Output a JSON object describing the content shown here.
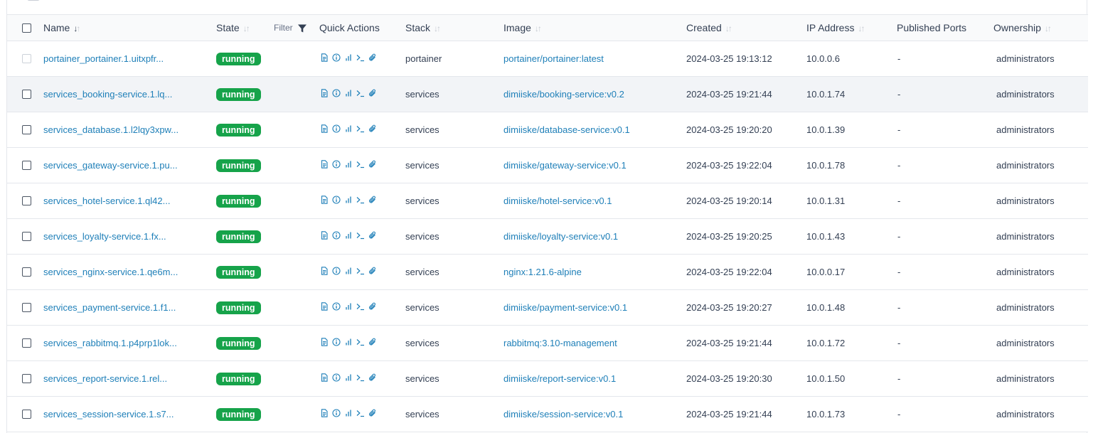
{
  "table": {
    "columns": {
      "name": "Name",
      "state": "State",
      "filter": "Filter",
      "quick_actions": "Quick Actions",
      "stack": "Stack",
      "image": "Image",
      "created": "Created",
      "ip": "IP Address",
      "ports": "Published Ports",
      "ownership": "Ownership"
    },
    "sort_active_arrow": "↓",
    "sort_arrows": "↓↑",
    "rows": [
      {
        "name": "portainer_portainer.1.uitxpfr...",
        "state": "running",
        "stack": "portainer",
        "image": "portainer/portainer:latest",
        "created": "2024-03-25 19:13:12",
        "ip": "10.0.0.6",
        "ports": "-",
        "ownership": "administrators",
        "selectable": false
      },
      {
        "name": "services_booking-service.1.lq...",
        "state": "running",
        "stack": "services",
        "image": "dimiiske/booking-service:v0.2",
        "created": "2024-03-25 19:21:44",
        "ip": "10.0.1.74",
        "ports": "-",
        "ownership": "administrators",
        "selectable": true
      },
      {
        "name": "services_database.1.l2lqy3xpw...",
        "state": "running",
        "stack": "services",
        "image": "dimiiske/database-service:v0.1",
        "created": "2024-03-25 19:20:20",
        "ip": "10.0.1.39",
        "ports": "-",
        "ownership": "administrators",
        "selectable": true
      },
      {
        "name": "services_gateway-service.1.pu...",
        "state": "running",
        "stack": "services",
        "image": "dimiiske/gateway-service:v0.1",
        "created": "2024-03-25 19:22:04",
        "ip": "10.0.1.78",
        "ports": "-",
        "ownership": "administrators",
        "selectable": true
      },
      {
        "name": "services_hotel-service.1.ql42...",
        "state": "running",
        "stack": "services",
        "image": "dimiiske/hotel-service:v0.1",
        "created": "2024-03-25 19:20:14",
        "ip": "10.0.1.31",
        "ports": "-",
        "ownership": "administrators",
        "selectable": true
      },
      {
        "name": "services_loyalty-service.1.fx...",
        "state": "running",
        "stack": "services",
        "image": "dimiiske/loyalty-service:v0.1",
        "created": "2024-03-25 19:20:25",
        "ip": "10.0.1.43",
        "ports": "-",
        "ownership": "administrators",
        "selectable": true
      },
      {
        "name": "services_nginx-service.1.qe6m...",
        "state": "running",
        "stack": "services",
        "image": "nginx:1.21.6-alpine",
        "created": "2024-03-25 19:22:04",
        "ip": "10.0.0.17",
        "ports": "-",
        "ownership": "administrators",
        "selectable": true
      },
      {
        "name": "services_payment-service.1.f1...",
        "state": "running",
        "stack": "services",
        "image": "dimiiske/payment-service:v0.1",
        "created": "2024-03-25 19:20:27",
        "ip": "10.0.1.48",
        "ports": "-",
        "ownership": "administrators",
        "selectable": true
      },
      {
        "name": "services_rabbitmq.1.p4prp1lok...",
        "state": "running",
        "stack": "services",
        "image": "rabbitmq:3.10-management",
        "created": "2024-03-25 19:21:44",
        "ip": "10.0.1.72",
        "ports": "-",
        "ownership": "administrators",
        "selectable": true
      },
      {
        "name": "services_report-service.1.rel...",
        "state": "running",
        "stack": "services",
        "image": "dimiiske/report-service:v0.1",
        "created": "2024-03-25 19:20:30",
        "ip": "10.0.1.50",
        "ports": "-",
        "ownership": "administrators",
        "selectable": true
      },
      {
        "name": "services_session-service.1.s7...",
        "state": "running",
        "stack": "services",
        "image": "dimiiske/session-service:v0.1",
        "created": "2024-03-25 19:21:44",
        "ip": "10.0.1.73",
        "ports": "-",
        "ownership": "administrators",
        "selectable": true
      }
    ],
    "hovered_row": 1,
    "quick_action_icons": [
      "logs-icon",
      "inspect-icon",
      "stats-icon",
      "console-icon",
      "attach-icon"
    ]
  },
  "colors": {
    "link": "#1e7fb8",
    "running_badge": "#16a34a",
    "border": "#e4e7ec",
    "header_bg": "#f9fafb",
    "hover_bg": "#f2f4f7"
  }
}
